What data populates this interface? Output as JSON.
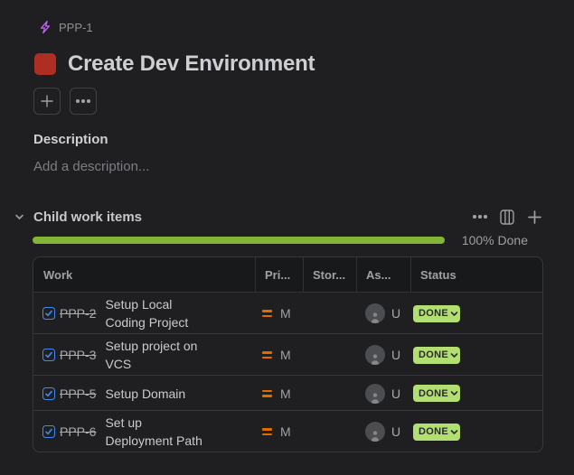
{
  "breadcrumb": {
    "parent_key": "PPP-1"
  },
  "page": {
    "title": "Create Dev Environment",
    "color_chip": "#ae2e24"
  },
  "description": {
    "heading": "Description",
    "placeholder": "Add a description..."
  },
  "child_items": {
    "heading": "Child work items",
    "progress_percent": 100,
    "progress_label": "100% Done",
    "progress_color": "#82b536",
    "columns": [
      "Work",
      "Pri...",
      "Stor...",
      "As...",
      "Status"
    ],
    "rows": [
      {
        "key": "PPP-2",
        "summary": "Setup Local Coding Project",
        "priority": "M",
        "assignee": "U",
        "status": "DONE",
        "completed": true
      },
      {
        "key": "PPP-3",
        "summary": "Setup project on VCS",
        "priority": "M",
        "assignee": "U",
        "status": "DONE",
        "completed": true
      },
      {
        "key": "PPP-5",
        "summary": "Setup Domain",
        "priority": "M",
        "assignee": "U",
        "status": "DONE",
        "completed": true
      },
      {
        "key": "PPP-6",
        "summary": "Set up Deployment Path",
        "priority": "M",
        "assignee": "U",
        "status": "DONE",
        "completed": true
      }
    ]
  },
  "colors": {
    "background": "#1f1f21",
    "table_header": "#18191a",
    "border": "#37373a",
    "accent_blue": "#4688ec",
    "priority_orange": "#e06c00",
    "done_badge": "#b3df72",
    "bolt_purple": "#bf63f3"
  }
}
